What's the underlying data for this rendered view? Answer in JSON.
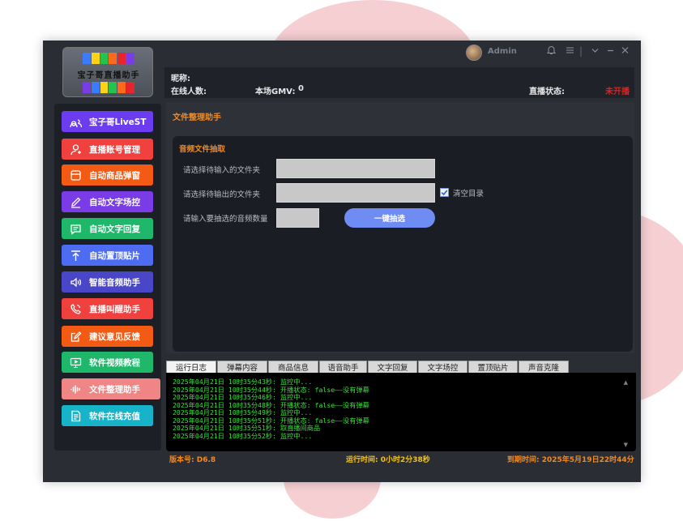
{
  "header": {
    "user": "Admin",
    "window_controls": [
      "bell-icon",
      "menu-icon",
      "chevron-down-icon",
      "minimize-icon",
      "close-icon"
    ]
  },
  "logo": {
    "text": "宝子哥直播助手"
  },
  "info": {
    "nickname_label": "昵称:",
    "online_label": "在线人数:",
    "gmv_label": "本场GMV:",
    "gmv_value": "0",
    "status_label": "直播状态:",
    "status_value": "未开播",
    "status_color": "#e02020"
  },
  "sidebar": {
    "items": [
      {
        "label": "宝子哥LiveST",
        "color": "#6c3cf0",
        "icon": "users-icon"
      },
      {
        "label": "直播账号管理",
        "color": "#f0413f",
        "icon": "user-icon"
      },
      {
        "label": "自动商品弹窗",
        "color": "#f35a13",
        "icon": "window-icon"
      },
      {
        "label": "自动文字场控",
        "color": "#7a3ce6",
        "icon": "pen-icon"
      },
      {
        "label": "自动文字回复",
        "color": "#1fb86a",
        "icon": "chat-icon"
      },
      {
        "label": "自动置顶贴片",
        "color": "#4d6cf2",
        "icon": "pin-top-icon"
      },
      {
        "label": "智能音频助手",
        "color": "#4a46c8",
        "icon": "speaker-icon"
      },
      {
        "label": "直播叫醒助手",
        "color": "#f0413f",
        "icon": "phone-icon"
      },
      {
        "label": "建议意见反馈",
        "color": "#f35a13",
        "icon": "edit-icon"
      },
      {
        "label": "软件视频教程",
        "color": "#1fb86a",
        "icon": "monitor-icon"
      },
      {
        "label": "文件整理助手",
        "color": "#f08585",
        "icon": "waveform-icon"
      },
      {
        "label": "软件在线充值",
        "color": "#17b3c8",
        "icon": "document-icon"
      }
    ]
  },
  "panel": {
    "title": "文件整理助手",
    "section_title": "音频文件抽取",
    "input_folder_label": "请选择待输入的文件夹",
    "output_folder_label": "请选择待输出的文件夹",
    "input_folder_value": "",
    "output_folder_value": "",
    "clear_dir_label": "清空目录",
    "clear_dir_checked": true,
    "count_label": "请输入要抽选的音频数量",
    "count_value": "",
    "run_button": "一键抽选"
  },
  "tabs": [
    "运行日志",
    "弹幕内容",
    "商品信息",
    "语音助手",
    "文字回复",
    "文字场控",
    "置顶贴片",
    "声音克隆"
  ],
  "log": [
    "2025年04月21日 10时35分43秒: 监控中...",
    "2025年04月21日 10时35分44秒: 开播状态: false——没有弹幕",
    "2025年04月21日 10时35分46秒: 监控中...",
    "2025年04月21日 10时35分48秒: 开播状态: false——没有弹幕",
    "2025年04月21日 10时35分49秒: 监控中...",
    "2025年04月21日 10时35分51秒: 开播状态: false——没有弹幕",
    "2025年04月21日 10时35分51秒: 取直播间商品",
    "2025年04月21日 10时35分52秒: 监控中..."
  ],
  "footer": {
    "version": "版本号: D6.8",
    "runtime": "运行时间: 0小时2分38秒",
    "expire": "到期时间: 2025年5月19日22时44分"
  }
}
